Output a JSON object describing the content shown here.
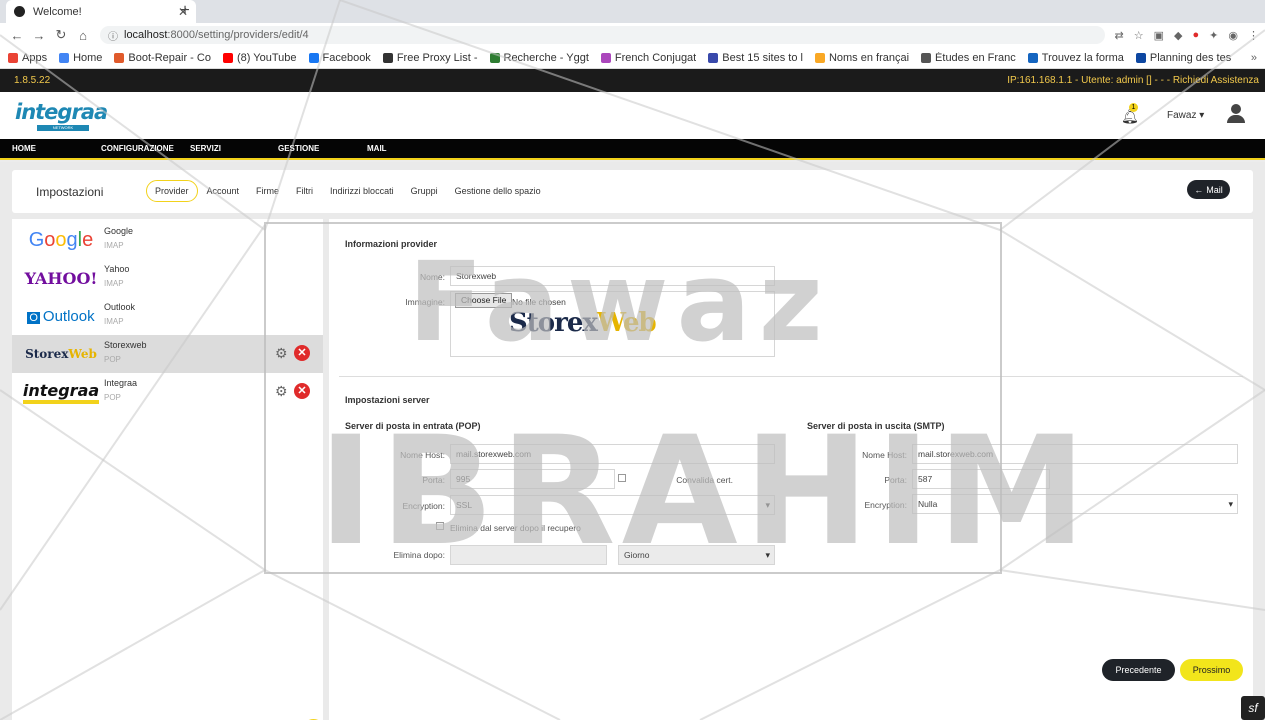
{
  "browser": {
    "tab_title": "Welcome!",
    "url_host": "localhost",
    "url_path": ":8000/setting/providers/edit/4",
    "bookmarks": [
      {
        "label": "Apps",
        "color": "#ea4335"
      },
      {
        "label": "Home",
        "color": "#4285f4"
      },
      {
        "label": "Boot-Repair - Co",
        "color": "#e05a2b"
      },
      {
        "label": "(8) YouTube",
        "color": "#ff0000"
      },
      {
        "label": "Facebook",
        "color": "#1877f2"
      },
      {
        "label": "Free Proxy List -",
        "color": "#333333"
      },
      {
        "label": "Recherche - Yggt",
        "color": "#2e7d32"
      },
      {
        "label": "French Conjugat",
        "color": "#ab47bc"
      },
      {
        "label": "Best 15 sites to l",
        "color": "#3949ab"
      },
      {
        "label": "Noms en françai",
        "color": "#f9a825"
      },
      {
        "label": "Études en Franc",
        "color": "#555555"
      },
      {
        "label": "Trouvez la forma",
        "color": "#1565c0"
      },
      {
        "label": "Planning des tes",
        "color": "#0d47a1"
      }
    ],
    "bookmarks_more": "»"
  },
  "topinfo": {
    "version": "1.8.5.22",
    "session": "IP:161.168.1.1 - Utente: admin [] - - - Richiedi Assistenza"
  },
  "header": {
    "logo_text": "integraa",
    "logo_sub": "NETWORK",
    "notification_count": "1",
    "user_name": "Fawaz"
  },
  "mainnav": [
    "HOME",
    "CONFIGURAZIONE",
    "SERVIZI",
    "GESTIONE",
    "MAIL"
  ],
  "settings": {
    "title": "Impostazioni",
    "tabs": [
      "Provider",
      "Account",
      "Firme",
      "Filtri",
      "Indirizzi bloccati",
      "Gruppi",
      "Gestione dello spazio"
    ],
    "active_tab": "Provider",
    "mail_button": "Mail"
  },
  "providers": [
    {
      "name": "Google",
      "type": "IMAP",
      "logo": "Google",
      "editable": false
    },
    {
      "name": "Yahoo",
      "type": "IMAP",
      "logo": "YAHOO!",
      "editable": false
    },
    {
      "name": "Outlook",
      "type": "IMAP",
      "logo": "Outlook",
      "editable": false
    },
    {
      "name": "Storexweb",
      "type": "POP",
      "logo": "StorexWeb",
      "editable": true,
      "active": true
    },
    {
      "name": "Integraa",
      "type": "POP",
      "logo": "integraa",
      "editable": true
    }
  ],
  "form": {
    "provider_section": "Informazioni provider",
    "name_label": "Nome:",
    "name_value": "Storexweb",
    "image_label": "Immagine:",
    "file_button": "Choose File",
    "file_status": "No file chosen",
    "preview_logo": "StorexWeb",
    "server_section": "Impostazioni server",
    "incoming": {
      "title": "Server di posta in entrata (POP)",
      "host_label": "Nome Host:",
      "host_value": "mail.storexweb.com",
      "port_label": "Porta:",
      "port_value": "995",
      "validate_label": "Convalida cert.",
      "encryption_label": "Encryption:",
      "encryption_value": "SSL",
      "delete_label": "Elimina dal server dopo il recupero",
      "delete_after_label": "Elimina dopo:",
      "delete_after_unit": "Giorno"
    },
    "outgoing": {
      "title": "Server di posta in uscita (SMTP)",
      "host_label": "Nome Host:",
      "host_value": "mail.storexweb.com",
      "port_label": "Porta:",
      "port_value": "587",
      "encryption_label": "Encryption:",
      "encryption_value": "Nulla"
    },
    "prev_button": "Precedente",
    "next_button": "Prossimo"
  },
  "watermark": {
    "line1": "Fawaz",
    "line2": "IBRAHIM"
  }
}
